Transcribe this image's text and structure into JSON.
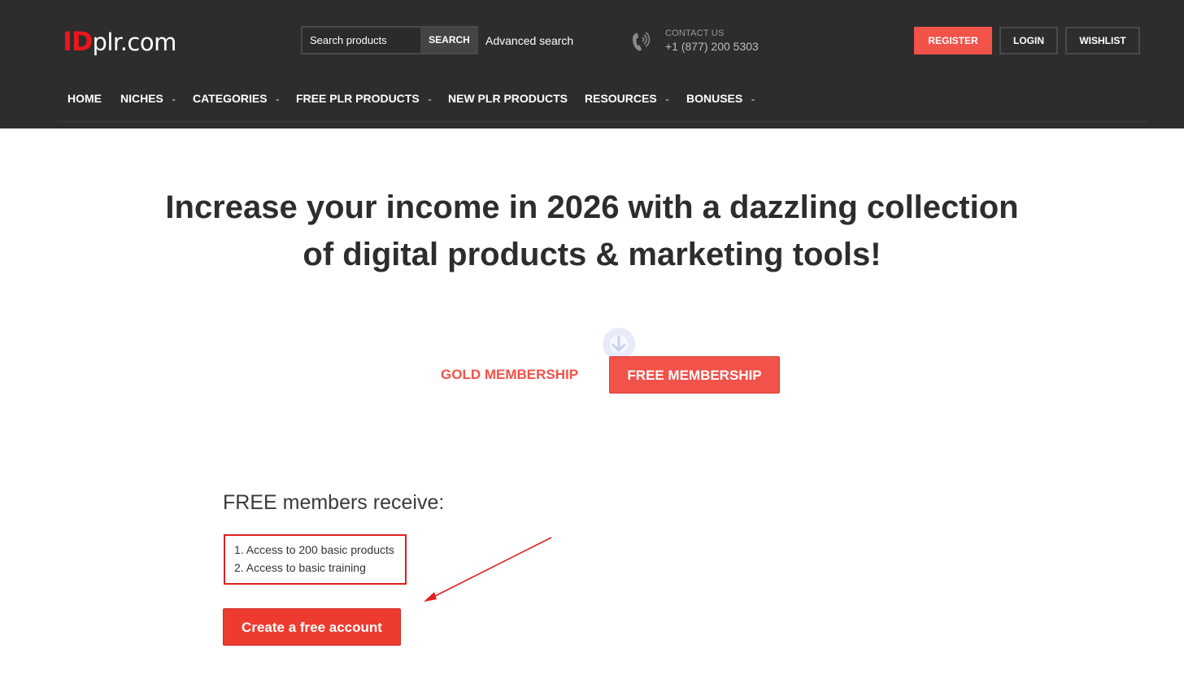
{
  "brand": {
    "logo_id": "ID",
    "logo_rest": "plr.com",
    "accent": "#e8171b"
  },
  "header": {
    "search_placeholder": "Search products",
    "search_button": "SEARCH",
    "advanced_search": "Advanced search",
    "contact_label": "CONTACT US",
    "contact_phone": "+1 (877) 200 5303",
    "phone_icon": "phone-icon",
    "register": "REGISTER",
    "login": "LOGIN",
    "wishlist": "WISHLIST",
    "colors": {
      "background": "#2d2d2d",
      "button_accent": "#f1524a"
    }
  },
  "nav": {
    "items": [
      {
        "label": "HOME",
        "has_dropdown": false
      },
      {
        "label": "NICHES",
        "has_dropdown": true
      },
      {
        "label": "CATEGORIES",
        "has_dropdown": true
      },
      {
        "label": "FREE PLR PRODUCTS",
        "has_dropdown": true
      },
      {
        "label": "NEW PLR PRODUCTS",
        "has_dropdown": false
      },
      {
        "label": "RESOURCES",
        "has_dropdown": true
      },
      {
        "label": "BONUSES",
        "has_dropdown": true
      }
    ],
    "dropdown_icon": "chevron-down-icon"
  },
  "hero": {
    "line1": "Increase your income in 2026 with a dazzling collection",
    "line2": "of digital products & marketing tools!"
  },
  "membership_tabs": {
    "gold": "GOLD MEMBERSHIP",
    "free": "FREE MEMBERSHIP",
    "active": "free"
  },
  "free_section": {
    "title": "FREE members receive:",
    "benefits": [
      "1. Access to 200 basic products",
      "2. Access to basic training"
    ],
    "cta": "Create a free account",
    "highlight_color": "#e02020"
  }
}
